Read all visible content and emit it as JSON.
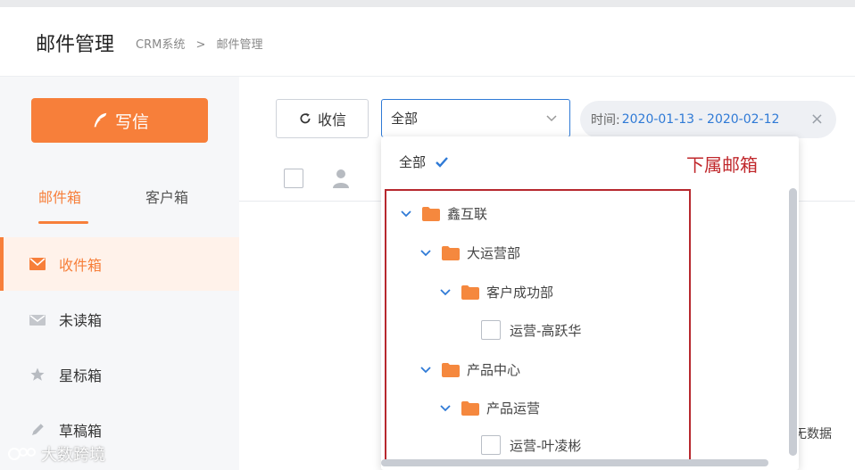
{
  "header": {
    "title": "邮件管理",
    "breadcrumb": [
      "CRM系统",
      ">",
      "邮件管理"
    ]
  },
  "sidebar": {
    "compose_label": "写信",
    "tabs": [
      {
        "label": "邮件箱",
        "active": true
      },
      {
        "label": "客户箱",
        "active": false
      }
    ],
    "folders": [
      {
        "label": "收件箱",
        "icon": "envelope-icon",
        "active": true
      },
      {
        "label": "未读箱",
        "icon": "unread-envelope-icon",
        "active": false
      },
      {
        "label": "星标箱",
        "icon": "star-icon",
        "active": false
      },
      {
        "label": "草稿箱",
        "icon": "pencil-icon",
        "active": false
      }
    ]
  },
  "toolbar": {
    "refresh_label": "收信",
    "select_value": "全部",
    "date_prefix": "时间:",
    "date_range": "2020-01-13 - 2020-02-12",
    "clear_symbol": "×"
  },
  "dropdown": {
    "all_label": "全部",
    "annotation": "下属邮箱",
    "tree": [
      {
        "label": "鑫互联",
        "type": "folder"
      },
      {
        "label": "大运营部",
        "type": "folder"
      },
      {
        "label": "客户成功部",
        "type": "folder"
      },
      {
        "label": "运营-高跃华",
        "type": "user"
      },
      {
        "label": "产品中心",
        "type": "folder"
      },
      {
        "label": "产品运营",
        "type": "folder"
      },
      {
        "label": "运营-叶凌彬",
        "type": "user"
      }
    ]
  },
  "list": {
    "empty_text": "无数据"
  },
  "watermark": "大数跨境",
  "colors": {
    "accent": "#f77f3a",
    "link_blue": "#2f7ad6",
    "annotation_red": "#c0282c"
  }
}
